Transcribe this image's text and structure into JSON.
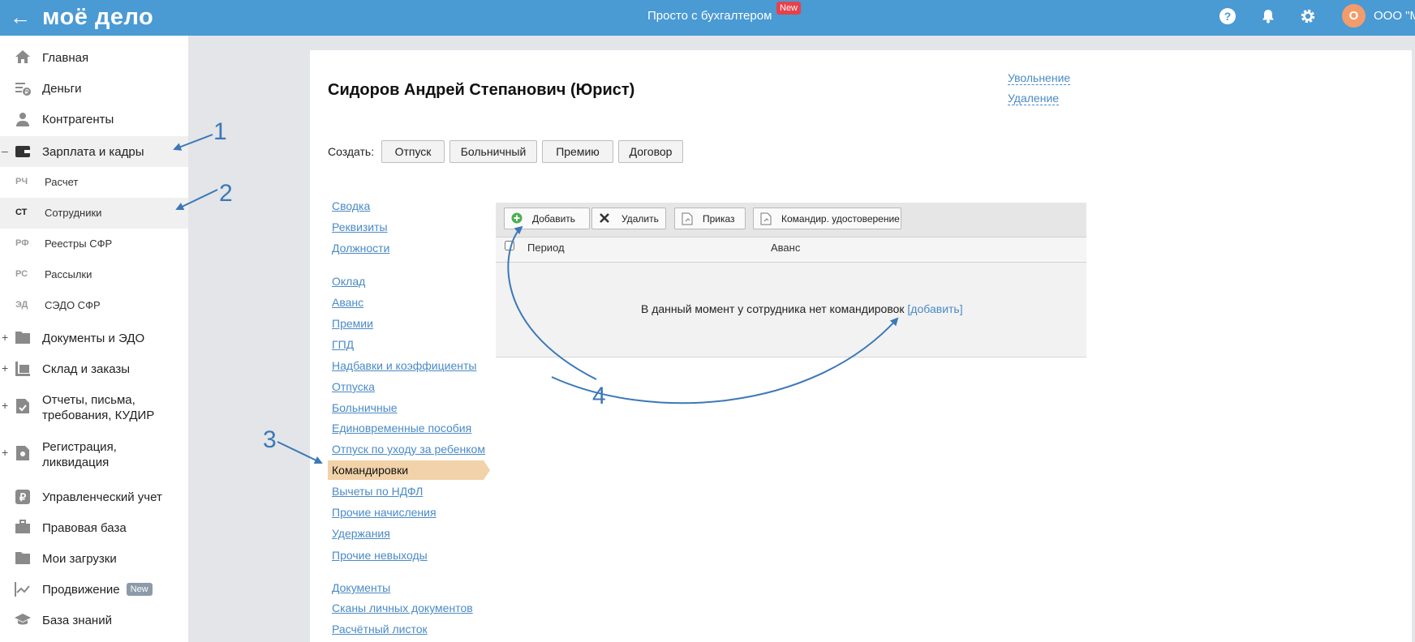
{
  "topbar": {
    "logo": "моё дело",
    "center_title": "Просто с бухгалтером",
    "new_badge": "New",
    "avatar_letter": "О",
    "company": "ООО \"М"
  },
  "sidebar": {
    "items": [
      {
        "label": "Главная",
        "icon": "home-icon"
      },
      {
        "label": "Деньги",
        "icon": "money-icon"
      },
      {
        "label": "Контрагенты",
        "icon": "contractors-icon"
      },
      {
        "label": "Зарплата и кадры",
        "icon": "wallet-icon",
        "expander": "–"
      },
      {
        "label": "Документы и ЭДО",
        "icon": "folder-icon",
        "expander": "+"
      },
      {
        "label": "Склад и заказы",
        "icon": "warehouse-icon",
        "expander": "+"
      },
      {
        "label": "Отчеты, письма, требования, КУДИР",
        "icon": "report-icon",
        "expander": "+"
      },
      {
        "label": "Регистрация, ликвидация",
        "icon": "registration-icon",
        "expander": "+"
      },
      {
        "label": "Управленческий учет",
        "icon": "ruble-icon"
      },
      {
        "label": "Правовая база",
        "icon": "briefcase-icon"
      },
      {
        "label": "Мои загрузки",
        "icon": "downloads-folder-icon"
      },
      {
        "label": "Продвижение",
        "icon": "chart-icon",
        "badge": "New"
      },
      {
        "label": "База знаний",
        "icon": "graduation-cap-icon"
      }
    ],
    "subitems": [
      {
        "abbr": "РЧ",
        "label": "Расчет"
      },
      {
        "abbr": "СТ",
        "label": "Сотрудники"
      },
      {
        "abbr": "РФ",
        "label": "Реестры СФР"
      },
      {
        "abbr": "РС",
        "label": "Рассылки"
      },
      {
        "abbr": "ЭД",
        "label": "СЭДО СФР"
      }
    ]
  },
  "employee": {
    "name": "Сидоров Андрей Степанович (Юрист)",
    "dismissal_link": "Увольнение",
    "delete_link": "Удаление"
  },
  "create": {
    "label": "Создать:",
    "buttons": [
      "Отпуск",
      "Больничный",
      "Премию",
      "Договор"
    ]
  },
  "side_links": {
    "group1": [
      "Сводка",
      "Реквизиты",
      "Должности"
    ],
    "group2": [
      "Оклад",
      "Аванс",
      "Премии",
      "ГПД",
      "Надбавки и коэффициенты",
      "Отпуска",
      "Больничные",
      "Единовременные пособия",
      "Отпуск по уходу за ребенком"
    ],
    "active": "Командировки",
    "group3": [
      "Вычеты по НДФЛ",
      "Прочие начисления",
      "Удержания",
      "Прочие невыходы"
    ],
    "group4": [
      "Документы",
      "Сканы личных документов",
      "Расчётный листок"
    ]
  },
  "toolbar": {
    "add": "Добавить",
    "delete": "Удалить",
    "order": "Приказ",
    "certificate": "Командир. удостоверение"
  },
  "table": {
    "columns": [
      "Период",
      "Аванс"
    ],
    "empty_message": "В данный момент у сотрудника нет командировок",
    "empty_link": "[добавить]"
  },
  "annotations": [
    "1",
    "2",
    "3",
    "4"
  ]
}
